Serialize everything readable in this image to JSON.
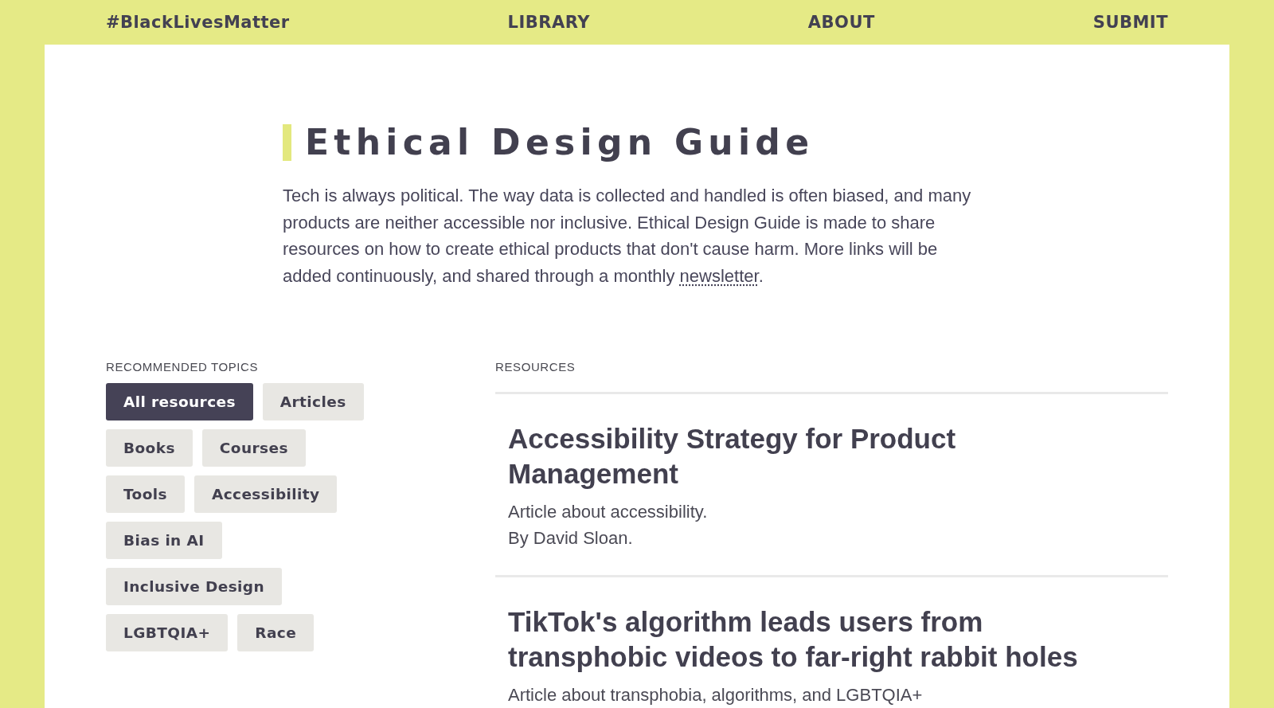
{
  "nav": {
    "brand": "#BlackLivesMatter",
    "links": [
      "LIBRARY",
      "ABOUT",
      "SUBMIT"
    ]
  },
  "intro": {
    "title": "Ethical Design Guide",
    "text": "Tech is always political. The way data is collected and handled is often biased, and many products are neither accessible nor inclusive. Ethical Design Guide is made to share resources on how to create ethical products that don't cause harm. More links will be added continuously, and shared through a monthly",
    "link": "newsletter",
    "after_link": "."
  },
  "topics": {
    "heading": "RECOMMENDED TOPICS",
    "items": [
      {
        "label": "All resources",
        "selected": true
      },
      {
        "label": "Articles",
        "selected": false
      },
      {
        "label": "Books",
        "selected": false
      },
      {
        "label": "Courses",
        "selected": false
      },
      {
        "label": "Tools",
        "selected": false
      },
      {
        "label": "Accessibility",
        "selected": false
      },
      {
        "label": "Bias in AI",
        "selected": false
      },
      {
        "label": "Inclusive Design",
        "selected": false
      },
      {
        "label": "LGBTQIA+",
        "selected": false
      },
      {
        "label": "Race",
        "selected": false
      }
    ]
  },
  "resources": {
    "heading": "RESOURCES",
    "items": [
      {
        "title": "Accessibility Strategy for Product Management",
        "description": "Article about accessibility.",
        "author": "By David Sloan."
      },
      {
        "title": "TikTok's algorithm leads users from transphobic videos to far-right rabbit holes",
        "description": "Article about transphobia, algorithms, and LGBTQIA+"
      }
    ]
  }
}
